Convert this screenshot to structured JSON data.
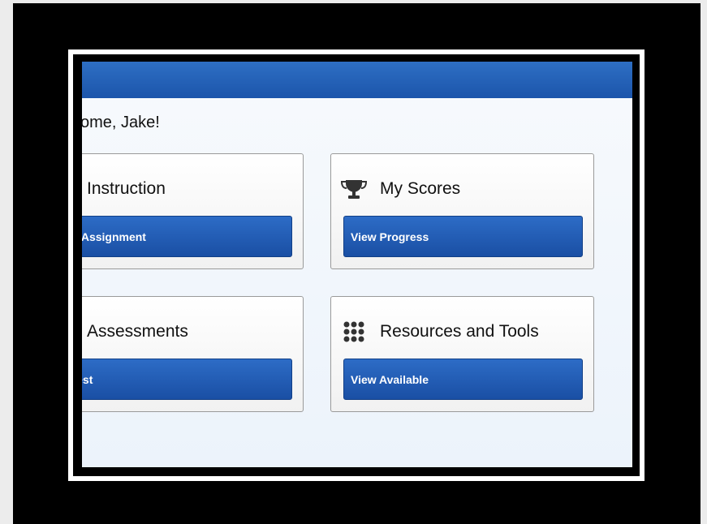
{
  "header": {
    "color": "#1f5bb0"
  },
  "welcome": {
    "text": "ome, Jake!"
  },
  "cards": [
    {
      "title": "Instruction",
      "icon": "",
      "button_label": "in An Assignment"
    },
    {
      "title": "My Scores",
      "icon": "trophy-icon",
      "button_label": "View Progress"
    },
    {
      "title": "Assessments",
      "icon": "",
      "button_label": "e A Test"
    },
    {
      "title": "Resources and Tools",
      "icon": "grid-dots-icon",
      "button_label": "View Available"
    }
  ]
}
